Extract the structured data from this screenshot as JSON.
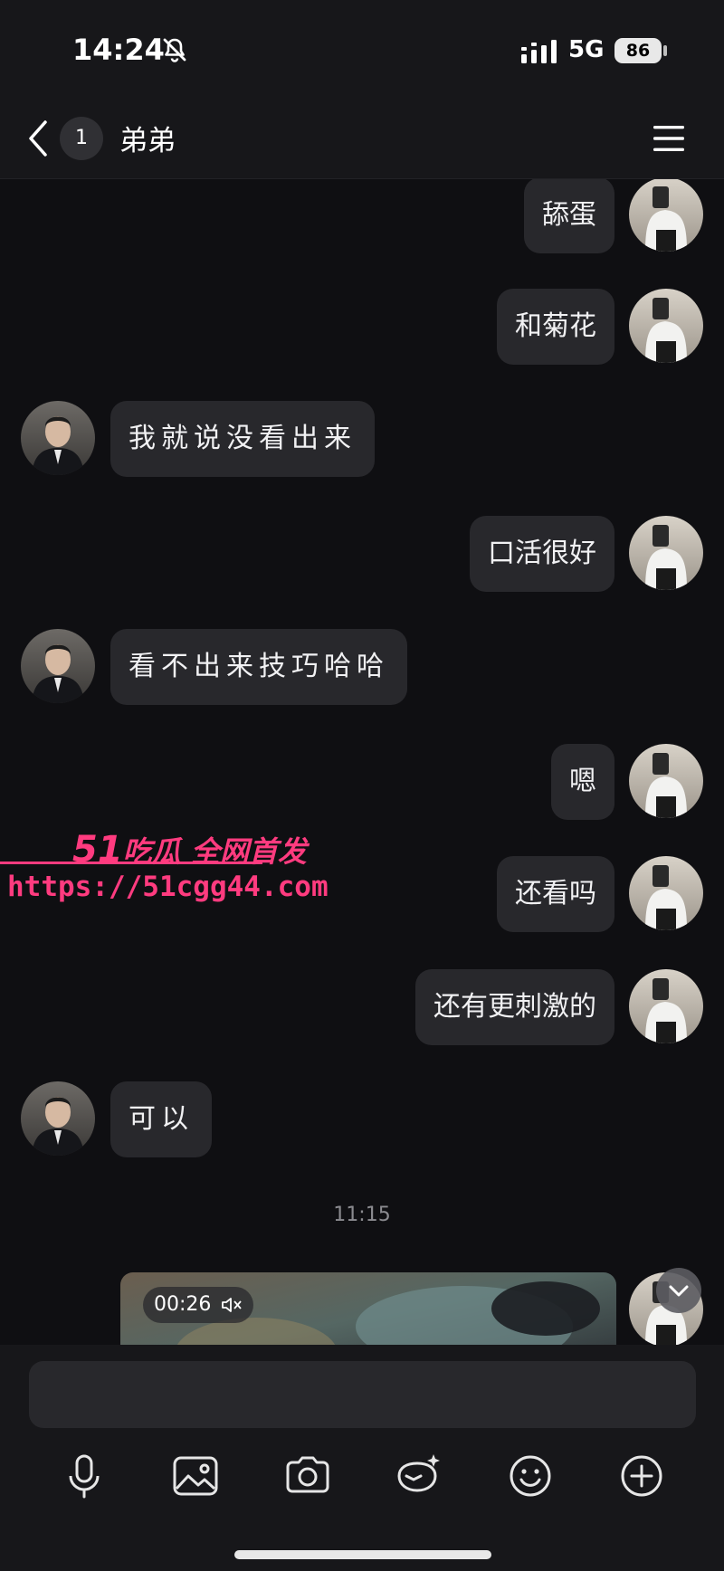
{
  "status_bar": {
    "time": "14:24",
    "network": "5G",
    "battery": "86"
  },
  "header": {
    "unread_count": "1",
    "title": "弟弟"
  },
  "messages": [
    {
      "side": "right",
      "text": "舔蛋"
    },
    {
      "side": "right",
      "text": "和菊花"
    },
    {
      "side": "left",
      "text": "我就说没看出来"
    },
    {
      "side": "right",
      "text": "口活很好"
    },
    {
      "side": "left",
      "text": "看不出来技巧哈哈"
    },
    {
      "side": "right",
      "text": "嗯"
    },
    {
      "side": "right",
      "text": "还看吗"
    },
    {
      "side": "right",
      "text": "还有更刺激的"
    },
    {
      "side": "left",
      "text": "可以"
    }
  ],
  "timestamp": "11:15",
  "video": {
    "duration": "00:26",
    "muted": true
  },
  "watermark": {
    "brand_number": "51",
    "brand_text": "吃瓜 全网首发",
    "url": "https://51cgg44.com"
  },
  "composer": {
    "input_value": "",
    "tools": [
      "microphone-icon",
      "image-icon",
      "camera-icon",
      "sticker-icon",
      "emoji-icon",
      "add-icon"
    ]
  },
  "colors": {
    "background": "#0f0f12",
    "bubble": "#28282c",
    "watermark": "#ff3b7f"
  }
}
